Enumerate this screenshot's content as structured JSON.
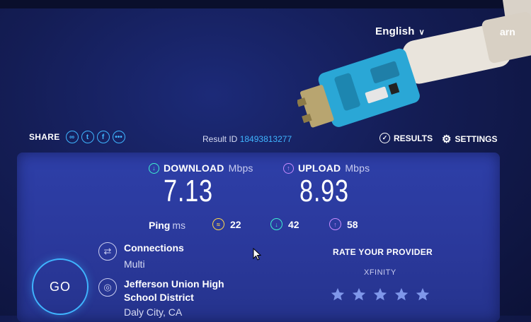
{
  "header": {
    "language": "English",
    "learn_partial": "arn"
  },
  "share": {
    "label": "SHARE",
    "icons": [
      "link-icon",
      "twitter-icon",
      "facebook-icon",
      "more-icon"
    ]
  },
  "result": {
    "label": "Result ID",
    "id": "18493813277"
  },
  "nav": {
    "results_label": "RESULTS",
    "settings_label": "SETTINGS"
  },
  "download": {
    "label": "DOWNLOAD",
    "unit": "Mbps",
    "value": "7.13"
  },
  "upload": {
    "label": "UPLOAD",
    "unit": "Mbps",
    "value": "8.93"
  },
  "ping": {
    "label": "Ping",
    "unit": "ms",
    "idle": "22",
    "download": "42",
    "upload": "58"
  },
  "connections": {
    "title": "Connections",
    "value": "Multi"
  },
  "server": {
    "title": "Jefferson Union High School District",
    "location": "Daly City, CA"
  },
  "go_label": "GO",
  "rating": {
    "title": "RATE YOUR PROVIDER",
    "provider": "XFINITY",
    "stars_filled": 0,
    "stars_total": 5
  },
  "colors": {
    "accent": "#3fb5ff",
    "download": "#3ff0d0",
    "upload": "#c98cff",
    "ping": "#ffd84a",
    "panel": "#2e3fa8"
  }
}
